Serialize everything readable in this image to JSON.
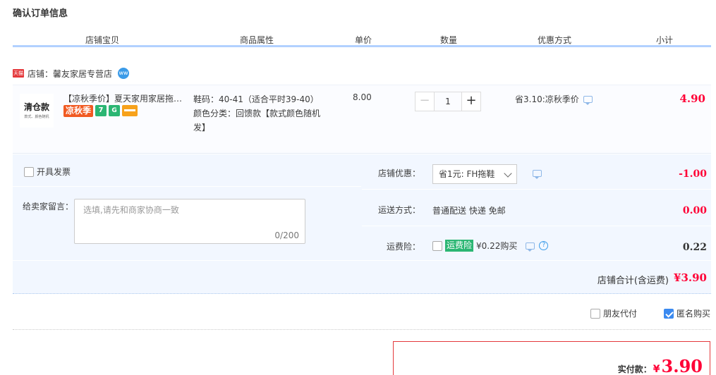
{
  "page": {
    "title": "确认订单信息"
  },
  "columns": [
    "店铺宝贝",
    "商品属性",
    "单价",
    "数量",
    "优惠方式",
    "小计"
  ],
  "shop": {
    "badge": "天猫",
    "name": "店铺：馨友家居专营店",
    "wangwang": "ww"
  },
  "item": {
    "thumb_main": "清仓款",
    "thumb_sub": "款式、颜色随机",
    "title": "【凉秋季价】夏天家用家居拖鞋男女士情侣室内居家防滑凉拖鞋",
    "badge_autumn": "凉秋季",
    "badge_7": "7",
    "badge_g": "G",
    "attr_size": "鞋码：40-41（适合平时39-40）",
    "attr_color": "颜色分类：回馈款【款式颜色随机发】",
    "unit_price": "8.00",
    "qty_minus": "−",
    "qty": "1",
    "qty_plus": "+",
    "promo": "省3.10:凉秋季价",
    "subtotal": "4.90"
  },
  "options": {
    "invoice_label": "开具发票",
    "message_label": "给卖家留言：",
    "message_placeholder": "选填,请先和商家协商一致",
    "message_count": "0/200",
    "shop_discount_label": "店铺优惠：",
    "shop_discount_value": "省1元: FH拖鞋",
    "shop_discount_amount": "-1.00",
    "shipping_label": "运送方式：",
    "shipping_value": "普通配送 快递 免邮",
    "shipping_amount": "0.00",
    "insurance_label": "运费险：",
    "insurance_badge": "运费险",
    "insurance_text": "¥0.22购买",
    "insurance_amount": "0.22"
  },
  "total": {
    "label": "店铺合计(含运费)",
    "value": "¥3.90"
  },
  "bottom": {
    "friend_pay": "朋友代付",
    "anonymous": "匿名购买"
  },
  "pay": {
    "label": "实付款：",
    "currency": "¥",
    "value": "3.90"
  }
}
